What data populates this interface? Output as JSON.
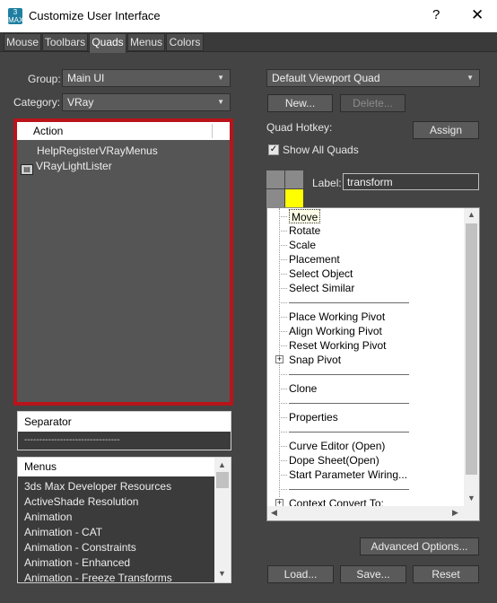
{
  "window": {
    "title": "Customize User Interface",
    "icon_text": "3 MAX",
    "help_glyph": "?",
    "close_glyph": "✕"
  },
  "tabs": [
    {
      "label": "Mouse"
    },
    {
      "label": "Toolbars"
    },
    {
      "label": "Quads"
    },
    {
      "label": "Menus"
    },
    {
      "label": "Colors"
    }
  ],
  "active_tab": "Quads",
  "left": {
    "group_label": "Group:",
    "group_value": "Main UI",
    "category_label": "Category:",
    "category_value": "VRay",
    "actions_header": "Action",
    "actions": [
      {
        "label": "HelpRegisterVRayMenus",
        "has_icon": false
      },
      {
        "label": "VRayLightLister",
        "has_icon": true,
        "icon": "light-lister-icon"
      }
    ],
    "separator_header": "Separator",
    "separator_item": "--------------------------------",
    "menus_header": "Menus",
    "menus": [
      "3ds Max Developer Resources",
      "ActiveShade Resolution",
      "Animation",
      "Animation - CAT",
      "Animation - Constraints",
      "Animation - Enhanced",
      "Animation - Freeze Transforms"
    ]
  },
  "right": {
    "quad_set_value": "Default Viewport Quad",
    "new_label": "New...",
    "delete_label": "Delete...",
    "hotkey_label": "Quad Hotkey:",
    "assign_label": "Assign",
    "show_all_label": "Show All Quads",
    "show_all_checked": true,
    "label_caption": "Label:",
    "label_value": "transform",
    "quad_tree": [
      {
        "type": "item",
        "label": "Move",
        "selected": true
      },
      {
        "type": "item",
        "label": "Rotate"
      },
      {
        "type": "item",
        "label": "Scale"
      },
      {
        "type": "item",
        "label": "Placement"
      },
      {
        "type": "item",
        "label": "Select Object"
      },
      {
        "type": "item",
        "label": "Select Similar"
      },
      {
        "type": "separator"
      },
      {
        "type": "item",
        "label": "Place Working Pivot"
      },
      {
        "type": "item",
        "label": "Align Working Pivot"
      },
      {
        "type": "item",
        "label": "Reset Working Pivot"
      },
      {
        "type": "item",
        "label": "Snap Pivot",
        "expandable": true
      },
      {
        "type": "separator"
      },
      {
        "type": "item",
        "label": "Clone"
      },
      {
        "type": "separator"
      },
      {
        "type": "item",
        "label": "Properties"
      },
      {
        "type": "separator"
      },
      {
        "type": "item",
        "label": "Curve Editor (Open)"
      },
      {
        "type": "item",
        "label": "Dope Sheet(Open)"
      },
      {
        "type": "item",
        "label": "Start Parameter Wiring..."
      },
      {
        "type": "separator"
      },
      {
        "type": "item",
        "label": "Context Convert To:",
        "expandable": true
      }
    ],
    "advanced_label": "Advanced Options...",
    "load_label": "Load...",
    "save_label": "Save...",
    "reset_label": "Reset"
  },
  "colors": {
    "highlight_frame": "#b8141a",
    "quad_selected": "#ffff00"
  }
}
